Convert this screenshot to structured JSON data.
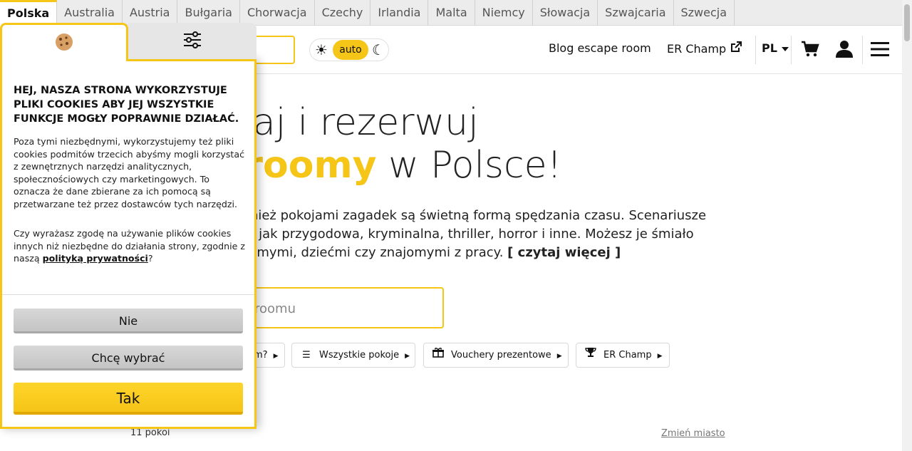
{
  "countries": [
    "Polska",
    "Australia",
    "Austria",
    "Bułgaria",
    "Chorwacja",
    "Czechy",
    "Irlandia",
    "Malta",
    "Niemcy",
    "Słowacja",
    "Szwajcaria",
    "Szwecja"
  ],
  "header": {
    "theme_auto": "auto",
    "blog": "Blog escape room",
    "er_champ": "ER Champ",
    "lang": "PL"
  },
  "hero": {
    "title_line1": "ądaj i rezerwuj",
    "title_highlight": "e roomy",
    "title_rest": " w Polsce!",
    "desc_line1": "ne również pokojami zagadek są świetną formą spędzania czasu. Scenariusze",
    "desc_line2": "matyki, jak przygodowa, kryminalna, thriller, horror i inne. Możesz je śmiało",
    "desc_line3": "ą, znajomymi, dziećmi czy znajomymi z pracy.",
    "read_more": "[ czytaj więcej ]",
    "search_placeholder": "roomu"
  },
  "chips": {
    "partial": "m?",
    "all_rooms": "Wszystkie pokoje",
    "vouchers": "Vouchery prezentowe",
    "er_champ": "ER Champ"
  },
  "footer": {
    "rooms_count": "11 pokoi",
    "change_city": "Zmień miasto"
  },
  "cookie": {
    "title": "HEJ, NASZA STRONA WYKORZYSTUJE PLIKI COOKIES ABY JEJ WSZYSTKIE FUNKCJE MOGŁY POPRAWNIE DZIAŁAĆ.",
    "text1": "Poza tymi niezbędnymi, wykorzystujemy też pliki cookies podmitów trzecich abyśmy mogli korzystać z zewnętrznych narzędzi analitycznych, społecznościowych czy marketingowych. To oznacza że dane zbierane za ich pomocą są przetwarzane też przez dostawców tych narzędzi.",
    "text2_before": "Czy wyrażasz zgodę na używanie plików cookies innych niż niezbędne do działania strony, zgodnie z naszą ",
    "privacy_link": "polityką prywatności",
    "text2_after": "?",
    "btn_no": "Nie",
    "btn_choose": "Chcę wybrać",
    "btn_yes": "Tak"
  },
  "colors": {
    "accent": "#f5c518"
  }
}
